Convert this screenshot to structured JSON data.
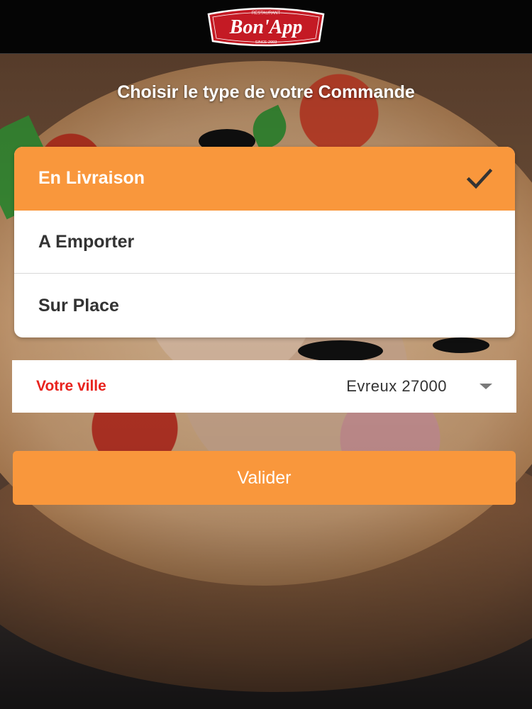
{
  "header": {
    "logo": {
      "brand": "Bon'App",
      "top_text": "RESTAURANT",
      "bottom_text": "SINCE 2003",
      "color": "#c41a24"
    }
  },
  "page": {
    "heading": "Choisir le type de votre Commande"
  },
  "order_types": [
    {
      "label": "En Livraison",
      "selected": true
    },
    {
      "label": "A Emporter",
      "selected": false
    },
    {
      "label": "Sur Place",
      "selected": false
    }
  ],
  "city": {
    "label": "Votre ville",
    "value": "Evreux 27000"
  },
  "validate_button": {
    "label": "Valider"
  },
  "colors": {
    "accent": "#f9973c",
    "city_label": "#e8231e",
    "header_bg": "#050505"
  },
  "icons": {
    "selected": "check-icon",
    "city_dropdown": "caret-down-icon"
  }
}
